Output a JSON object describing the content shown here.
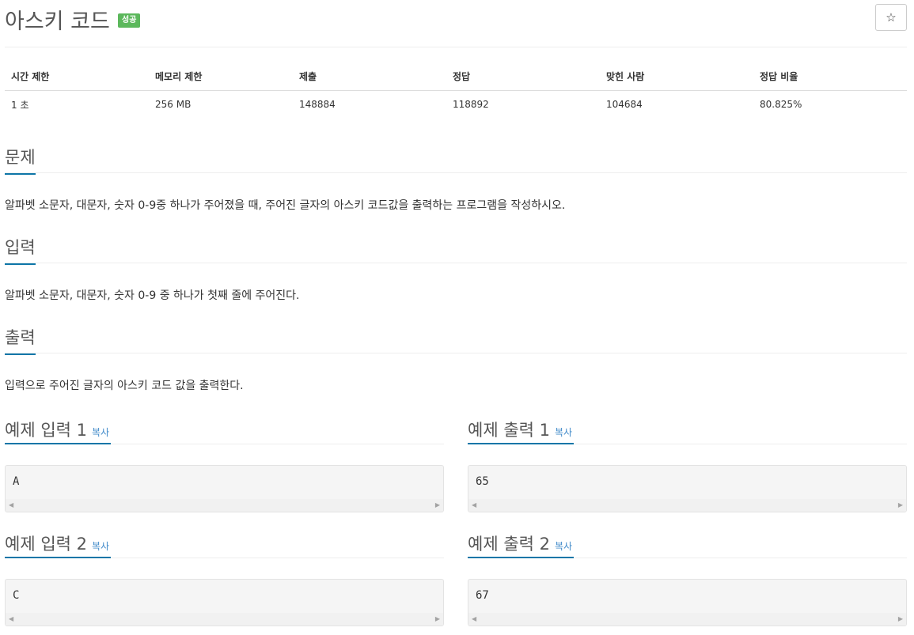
{
  "problem": {
    "title": "아스키 코드",
    "badge": "성공",
    "star_icon": "☆"
  },
  "stats": {
    "headers": [
      "시간 제한",
      "메모리 제한",
      "제출",
      "정답",
      "맞힌 사람",
      "정답 비율"
    ],
    "values": [
      "1 초",
      "256 MB",
      "148884",
      "118892",
      "104684",
      "80.825%"
    ]
  },
  "sections": {
    "description": {
      "title": "문제",
      "text": "알파벳 소문자, 대문자, 숫자 0-9중 하나가 주어졌을 때, 주어진 글자의 아스키 코드값을 출력하는 프로그램을 작성하시오."
    },
    "input": {
      "title": "입력",
      "text": "알파벳 소문자, 대문자, 숫자 0-9 중 하나가 첫째 줄에 주어진다."
    },
    "output": {
      "title": "출력",
      "text": "입력으로 주어진 글자의 아스키 코드 값을 출력한다."
    }
  },
  "samples": {
    "copy_label": "복사",
    "input1": {
      "title": "예제 입력 1",
      "value": "A"
    },
    "output1": {
      "title": "예제 출력 1",
      "value": "65"
    },
    "input2": {
      "title": "예제 입력 2",
      "value": "C"
    },
    "output2": {
      "title": "예제 출력 2",
      "value": "67"
    }
  },
  "colors": {
    "badge_success": "#5cb85c",
    "accent_underline": "#0e76a8",
    "link": "#428bca"
  }
}
